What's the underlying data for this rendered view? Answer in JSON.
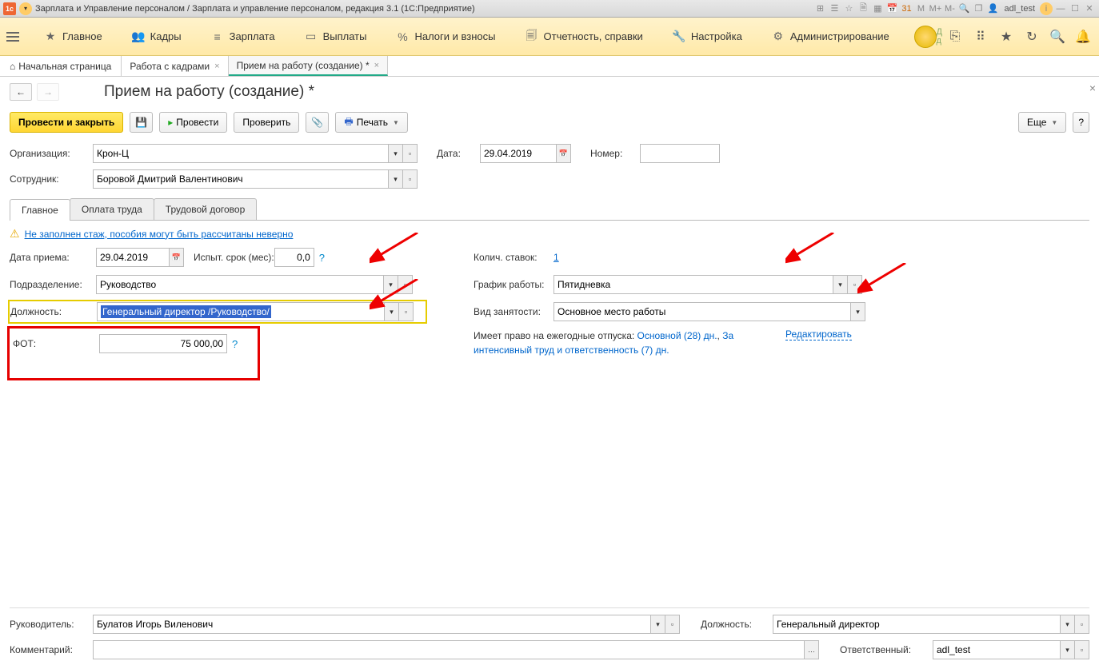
{
  "titlebar": {
    "text": "Зарплата и Управление персоналом / Зарплата и управление персоналом, редакция 3.1 (1С:Предприятие)",
    "user": "adl_test"
  },
  "nav": {
    "items": [
      {
        "label": "Главное"
      },
      {
        "label": "Кадры"
      },
      {
        "label": "Зарплата"
      },
      {
        "label": "Выплаты"
      },
      {
        "label": "Налоги и взносы"
      },
      {
        "label": "Отчетность, справки"
      },
      {
        "label": "Настройка"
      },
      {
        "label": "Администрирование"
      }
    ],
    "extra": "Д\nд"
  },
  "tabs": {
    "home": "Начальная страница",
    "items": [
      {
        "label": "Работа с кадрами"
      },
      {
        "label": "Прием на работу (создание) *",
        "active": true
      }
    ]
  },
  "page": {
    "title": "Прием на работу (создание) *"
  },
  "cmd": {
    "run_close": "Провести и закрыть",
    "run": "Провести",
    "check": "Проверить",
    "print": "Печать",
    "more": "Еще",
    "help": "?"
  },
  "head_fields": {
    "org_lbl": "Организация:",
    "org_val": "Крон-Ц",
    "date_lbl": "Дата:",
    "date_val": "29.04.2019",
    "num_lbl": "Номер:",
    "num_val": "",
    "emp_lbl": "Сотрудник:",
    "emp_val": "Боровой Дмитрий Валентинович"
  },
  "inner_tabs": {
    "main": "Главное",
    "pay": "Оплата труда",
    "contract": "Трудовой договор"
  },
  "warning": "Не заполнен стаж, пособия могут быть рассчитаны неверно",
  "left": {
    "date_lbl": "Дата приема:",
    "date_val": "29.04.2019",
    "probation_lbl": "Испыт. срок (мес):",
    "probation_val": "0,0",
    "dept_lbl": "Подразделение:",
    "dept_val": "Руководство",
    "pos_lbl": "Должность:",
    "pos_val": "Генеральный директор /Руководство/",
    "fot_lbl": "ФОТ:",
    "fot_val": "75 000,00"
  },
  "right": {
    "stakes_lbl": "Колич. ставок:",
    "stakes_val": "1",
    "schedule_lbl": "График работы:",
    "schedule_val": "Пятидневка",
    "emptype_lbl": "Вид занятости:",
    "emptype_val": "Основное место работы",
    "vacation_prefix": "Имеет право на ежегодные отпуска: ",
    "vacation_main": "Основной (28) дн.",
    "vacation_sep": ", ",
    "vacation_extra": "За интенсивный труд и ответственность (7) дн.",
    "edit": "Редактировать"
  },
  "footer": {
    "mgr_lbl": "Руководитель:",
    "mgr_val": "Булатов Игорь Виленович",
    "mgr_pos_lbl": "Должность:",
    "mgr_pos_val": "Генеральный директор",
    "comment_lbl": "Комментарий:",
    "comment_val": "",
    "resp_lbl": "Ответственный:",
    "resp_val": "adl_test"
  }
}
